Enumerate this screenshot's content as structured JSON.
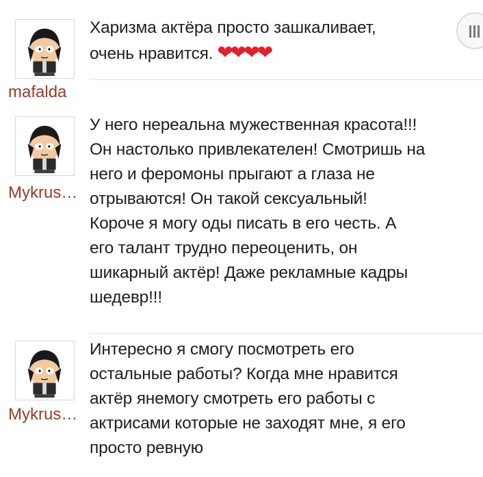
{
  "comments": [
    {
      "username": "mafalda",
      "lines": [
        "Харизма актёра просто зашкаливает,",
        "очень нравится."
      ],
      "hearts": "❤❤❤❤"
    },
    {
      "username": "Mykrus…",
      "lines": [
        "У него нереальна мужественная красота!!!",
        "Он настолько привлекателен! Смотришь на",
        "него и феромоны прыгают а глаза не",
        "отрываются! Он такой сексуальный!",
        "Короче я могу оды писать в его честь. А",
        "его талант трудно переоценить, он",
        "шикарный актёр! Даже рекламные кадры",
        "шедевр!!!"
      ]
    },
    {
      "username": "Mykrus…",
      "lines": [
        "Интересно я смогу посмотреть его",
        "остальные работы? Когда мне нравится",
        "актёр янемогу смотреть его работы с",
        "актрисами которые не заходят мне, я его",
        "просто ревную"
      ]
    }
  ],
  "colors": {
    "username": "#9b3b26",
    "text": "#1e1e1e",
    "heart": "#e41e2c"
  },
  "icons": {
    "avatar": "south-park-character-avatar",
    "menu": "menu-bars-icon"
  }
}
